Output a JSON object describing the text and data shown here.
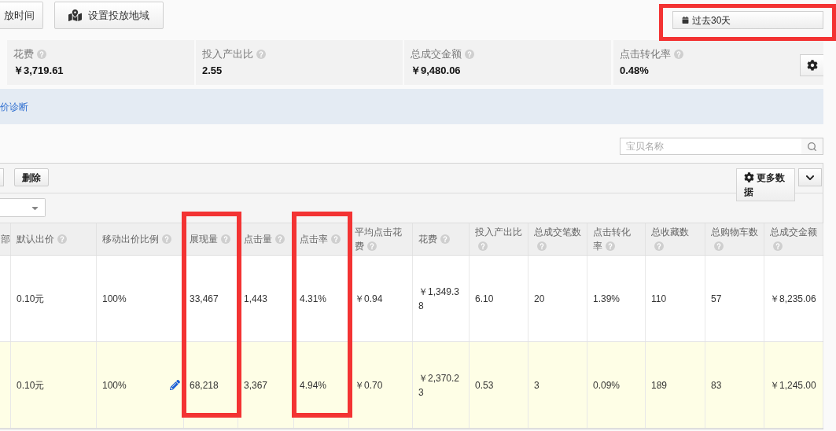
{
  "toolbar": {
    "buttons": [
      {
        "label": "放时间",
        "kind": "plain"
      },
      {
        "label": "设置投放地域",
        "kind": "map"
      }
    ],
    "date_range": {
      "label": "过去30天",
      "annotated": true
    }
  },
  "metrics": [
    {
      "label": "花费",
      "value": "￥3,719.61"
    },
    {
      "label": "投入产出比",
      "value": "2.55"
    },
    {
      "label": "总成交金额",
      "value": "￥9,480.06"
    },
    {
      "label": "点击转化率",
      "value": "0.48%"
    }
  ],
  "notice": {
    "link": "价诊断"
  },
  "search": {
    "placeholder": "宝贝名称"
  },
  "table_toolbar": {
    "delete_button": "删除",
    "more_data_button": "更多数据"
  },
  "table": {
    "columns": [
      {
        "label": "部",
        "help": false,
        "annotated": false
      },
      {
        "label": "默认出价",
        "help": true,
        "annotated": false
      },
      {
        "label": "移动出价比例",
        "help": true,
        "annotated": false
      },
      {
        "label": "展现量",
        "help": true,
        "annotated": true
      },
      {
        "label": "点击量",
        "help": true,
        "annotated": false
      },
      {
        "label": "点击率",
        "help": true,
        "annotated": true
      },
      {
        "label": "平均点击花费",
        "help": true,
        "annotated": false
      },
      {
        "label": "花费",
        "help": true,
        "annotated": false
      },
      {
        "label": "投入产出比",
        "help": true,
        "annotated": false
      },
      {
        "label": "总成交笔数",
        "help": true,
        "annotated": false
      },
      {
        "label": "点击转化率",
        "help": true,
        "annotated": false
      },
      {
        "label": "总收藏数",
        "help": true,
        "annotated": false
      },
      {
        "label": "总购物车数",
        "help": true,
        "annotated": false
      },
      {
        "label": "总成交金额",
        "help": true,
        "annotated": false
      }
    ],
    "rows": [
      {
        "selected": false,
        "editable": false,
        "cells": [
          "",
          "0.10元",
          "100%",
          "33,467",
          "1,443",
          "4.31%",
          "￥0.94",
          "￥1,349.38",
          "6.10",
          "20",
          "1.39%",
          "110",
          "57",
          "￥8,235.06"
        ]
      },
      {
        "selected": true,
        "editable": true,
        "cells": [
          "",
          "0.10元",
          "100%",
          "68,218",
          "3,367",
          "4.94%",
          "￥0.70",
          "￥2,370.23",
          "0.53",
          "3",
          "0.09%",
          "189",
          "83",
          "￥1,245.00"
        ]
      }
    ]
  }
}
